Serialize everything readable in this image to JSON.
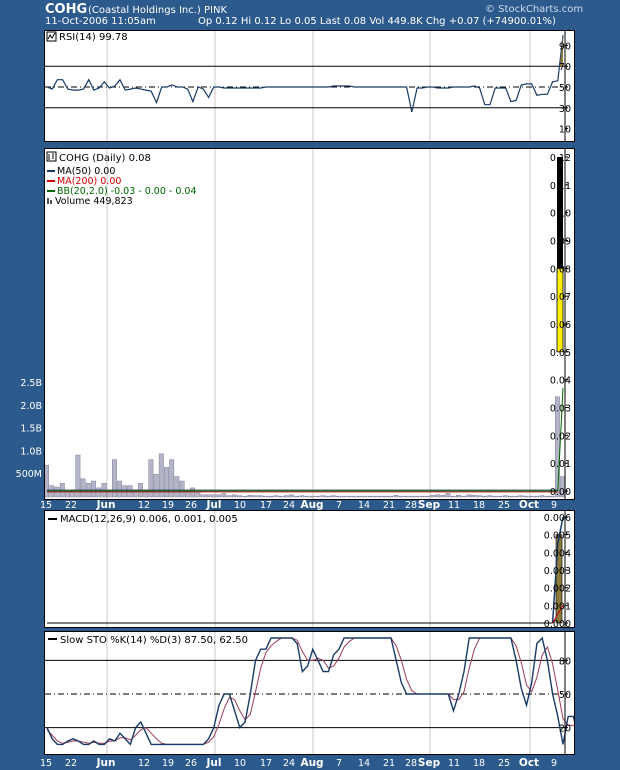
{
  "header": {
    "symbol": "COHG",
    "company": "(Coastal Holdings Inc.) PINK",
    "datetime": "11-Oct-2006 11:05am",
    "stats": "Op 0.12  Hi 0.12  Lo 0.05  Last 0.08  Vol 449.8K  Chg +0.07 (+74900.01%)",
    "watermark": "© StockCharts.com"
  },
  "colors": {
    "background": "#2d5a8c",
    "ma50": "#1a3a66",
    "ma200": "#cc0000",
    "bb": "#006600",
    "volume": "#b4b4c8",
    "candle": "#ffee00",
    "macd_signal": "#8a7a3c",
    "sto_d": "#9b3a5a"
  },
  "chart_data": [
    {
      "type": "line",
      "panel": "rsi",
      "title": "RSI(14) 99.78",
      "yticks": [
        "90",
        "70",
        "50",
        "30",
        "10"
      ],
      "ylim": [
        0,
        100
      ],
      "levels": [
        70,
        50,
        30
      ],
      "series": [
        {
          "name": "RSI(14)",
          "values": [
            50,
            48,
            57,
            57,
            48,
            47,
            47,
            48,
            57,
            47,
            49,
            55,
            49,
            51,
            57,
            47,
            48,
            49,
            48,
            47,
            46,
            35,
            50,
            50,
            52,
            50,
            50,
            48,
            36,
            50,
            48,
            40,
            50,
            50,
            49,
            49,
            49,
            49,
            49,
            49,
            49,
            49,
            50,
            50,
            50,
            50,
            50,
            50,
            50,
            50,
            50,
            50,
            50,
            50,
            50,
            51,
            51,
            51,
            51,
            50,
            50,
            50,
            50,
            50,
            50,
            50,
            50,
            50,
            50,
            50,
            26,
            49,
            49,
            50,
            50,
            49,
            49,
            49,
            50,
            50,
            50,
            50,
            51,
            49,
            33,
            33,
            49,
            49,
            49,
            36,
            37,
            52,
            53,
            53,
            42,
            43,
            43,
            55,
            56,
            99.78
          ]
        }
      ]
    },
    {
      "type": "bar",
      "panel": "price",
      "title": "COHG (Daily) 0.08",
      "legend": [
        "MA(50) 0.00",
        "MA(200) 0.00",
        "BB(20,2.0) -0.03 - 0.00 - 0.04",
        "Volume 449,823"
      ],
      "yticks": [
        "0.12",
        "0.11",
        "0.10",
        "0.09",
        "0.08",
        "0.07",
        "0.06",
        "0.05",
        "0.04",
        "0.03",
        "0.02",
        "0.01",
        "0.00"
      ],
      "ylim": [
        0,
        0.12
      ],
      "candle": {
        "open": 0.12,
        "high": 0.12,
        "low": 0.05,
        "close": 0.08
      },
      "volume_ticks": [
        "2.5B",
        "2.0B",
        "1.5B",
        "1.0B",
        "500M"
      ],
      "volume_ylim": [
        0,
        2.5
      ],
      "volume": [
        0.7,
        0.25,
        0.22,
        0.3,
        0.12,
        0.15,
        0.92,
        0.4,
        0.3,
        0.35,
        0.2,
        0.3,
        0.15,
        0.82,
        0.35,
        0.25,
        0.25,
        0.15,
        0.3,
        0.15,
        0.82,
        0.5,
        0.95,
        0.65,
        0.82,
        0.45,
        0.35,
        0.15,
        0.2,
        0.1,
        0.05,
        0.05,
        0.05,
        0.05,
        0.08,
        0.03,
        0.05,
        0.03,
        0.02,
        0.04,
        0.03,
        0.03,
        0.02,
        0.02,
        0.03,
        0.02,
        0.03,
        0.05,
        0.02,
        0.03,
        0.02,
        0.02,
        0.02,
        0.03,
        0.02,
        0.03,
        0.02,
        0.02,
        0.02,
        0.02,
        0.02,
        0.02,
        0.02,
        0.02,
        0.02,
        0.02,
        0.02,
        0.04,
        0.02,
        0.02,
        0.02,
        0.02,
        0.02,
        0.02,
        0.04,
        0.05,
        0.04,
        0.08,
        0.02,
        0.04,
        0.02,
        0.05,
        0.04,
        0.03,
        0.02,
        0.03,
        0.02,
        0.02,
        0.03,
        0.02,
        0.02,
        0.03,
        0.02,
        0.02,
        0.02,
        0.03,
        0.02,
        0.02,
        2.2,
        0.45
      ]
    },
    {
      "type": "line",
      "panel": "macd",
      "title": "MACD(12,26,9) 0.006, 0.001, 0.005",
      "yticks": [
        "0.006",
        "0.005",
        "0.004",
        "0.003",
        "0.002",
        "0.001",
        "0.000"
      ],
      "ylim": [
        0,
        0.006
      ],
      "histogram_last": 0.005,
      "series": [
        {
          "name": "MACD",
          "values_last": [
            0.0,
            0.0045,
            0.006
          ]
        }
      ]
    },
    {
      "type": "line",
      "panel": "sto",
      "title": "Slow STO %K(14) %D(3) 87.50, 62.50",
      "yticks": [
        "80",
        "50",
        "20"
      ],
      "ylim": [
        0,
        100
      ],
      "levels": [
        80,
        50,
        20
      ],
      "series": [
        {
          "name": "%K",
          "values": [
            20,
            10,
            5,
            5,
            8,
            10,
            8,
            5,
            5,
            8,
            5,
            5,
            10,
            8,
            15,
            10,
            5,
            20,
            25,
            15,
            5,
            5,
            5,
            5,
            5,
            5,
            5,
            5,
            5,
            5,
            5,
            10,
            20,
            40,
            50,
            50,
            35,
            20,
            25,
            50,
            80,
            90,
            90,
            100,
            100,
            100,
            100,
            100,
            95,
            70,
            75,
            90,
            80,
            70,
            70,
            85,
            90,
            100,
            100,
            100,
            100,
            100,
            100,
            100,
            100,
            100,
            100,
            80,
            60,
            50,
            50,
            50,
            50,
            50,
            50,
            50,
            50,
            50,
            35,
            50,
            70,
            100,
            100,
            100,
            100,
            100,
            100,
            100,
            100,
            100,
            80,
            55,
            40,
            60,
            95,
            100,
            80,
            50,
            30,
            5,
            30,
            30,
            10,
            5,
            25,
            87.5
          ]
        },
        {
          "name": "%D",
          "values": [
            18,
            13,
            8,
            6,
            7,
            8,
            8,
            7,
            6,
            7,
            6,
            6,
            8,
            8,
            11,
            11,
            9,
            13,
            18,
            20,
            15,
            10,
            6,
            5,
            5,
            5,
            5,
            5,
            5,
            5,
            5,
            7,
            12,
            23,
            37,
            47,
            45,
            35,
            27,
            32,
            52,
            73,
            87,
            93,
            97,
            100,
            100,
            100,
            98,
            88,
            80,
            80,
            82,
            80,
            73,
            75,
            82,
            92,
            97,
            100,
            100,
            100,
            100,
            100,
            100,
            100,
            100,
            93,
            80,
            63,
            53,
            50,
            50,
            50,
            50,
            50,
            50,
            50,
            45,
            45,
            52,
            73,
            90,
            100,
            100,
            100,
            100,
            100,
            100,
            100,
            93,
            78,
            58,
            52,
            65,
            85,
            92,
            77,
            53,
            28,
            22,
            22,
            22,
            15,
            13,
            40,
            62.5
          ]
        }
      ]
    }
  ],
  "x_axis": {
    "labels": [
      "15",
      "22",
      "Jun",
      "12",
      "19",
      "26",
      "Jul",
      "10",
      "17",
      "24",
      "Aug",
      "7",
      "14",
      "21",
      "28",
      "Sep",
      "11",
      "18",
      "25",
      "Oct",
      "9"
    ],
    "bold": [
      "Jun",
      "Jul",
      "Aug",
      "Sep",
      "Oct"
    ]
  }
}
